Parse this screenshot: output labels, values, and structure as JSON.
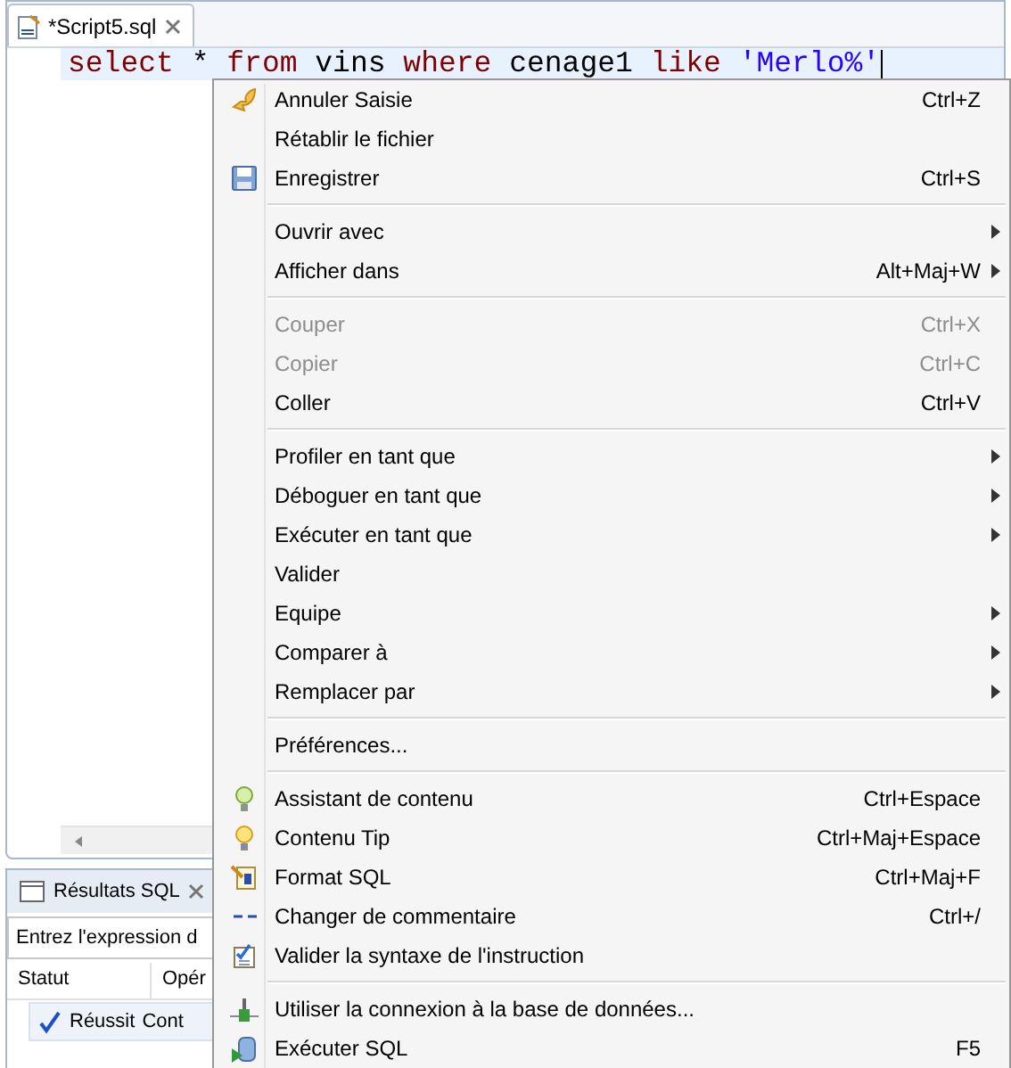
{
  "editor": {
    "tab": {
      "title": "*Script5.sql",
      "selected": true
    },
    "code": [
      {
        "kind": "keyword",
        "text": "select"
      },
      {
        "kind": "plain",
        "text": "*"
      },
      {
        "kind": "keyword",
        "text": "from"
      },
      {
        "kind": "plain",
        "text": "vins"
      },
      {
        "kind": "keyword",
        "text": "where"
      },
      {
        "kind": "plain",
        "text": "cenage1"
      },
      {
        "kind": "keyword",
        "text": "like"
      },
      {
        "kind": "string",
        "text": "'Merlo%'"
      }
    ]
  },
  "results": {
    "tab": {
      "title": "Résultats SQL",
      "selected": false
    },
    "filter": {
      "placeholder": "Entrez l'expression d"
    },
    "columns": [
      "Statut",
      "Opér"
    ],
    "rows": [
      {
        "status": "Réussit",
        "operation": "Cont",
        "selected": true
      }
    ]
  },
  "menu": {
    "items": [
      {
        "kind": "undo",
        "label": "Annuler Saisie",
        "shortcut": "Ctrl+Z",
        "disabled": false
      },
      {
        "kind": "item",
        "label": "Rétablir le fichier",
        "disabled": false
      },
      {
        "kind": "save",
        "label": "Enregistrer",
        "shortcut": "Ctrl+S",
        "disabled": false
      },
      {
        "kind": "separator"
      },
      {
        "kind": "item",
        "label": "Ouvrir avec",
        "submenu": true,
        "disabled": false
      },
      {
        "kind": "item",
        "label": "Afficher dans",
        "shortcut": "Alt+Maj+W",
        "submenu": true,
        "disabled": false
      },
      {
        "kind": "separator"
      },
      {
        "kind": "item",
        "label": "Couper",
        "shortcut": "Ctrl+X",
        "disabled": true
      },
      {
        "kind": "item",
        "label": "Copier",
        "shortcut": "Ctrl+C",
        "disabled": true
      },
      {
        "kind": "item",
        "label": "Coller",
        "shortcut": "Ctrl+V",
        "disabled": false
      },
      {
        "kind": "separator"
      },
      {
        "kind": "item",
        "label": "Profiler en tant que",
        "submenu": true,
        "disabled": false
      },
      {
        "kind": "item",
        "label": "Déboguer en tant que",
        "submenu": true,
        "disabled": false
      },
      {
        "kind": "item",
        "label": "Exécuter en tant que",
        "submenu": true,
        "disabled": false
      },
      {
        "kind": "item",
        "label": "Valider",
        "disabled": false
      },
      {
        "kind": "item",
        "label": "Equipe",
        "submenu": true,
        "disabled": false
      },
      {
        "kind": "item",
        "label": "Comparer à",
        "submenu": true,
        "disabled": false
      },
      {
        "kind": "item",
        "label": "Remplacer par",
        "submenu": true,
        "disabled": false
      },
      {
        "kind": "separator"
      },
      {
        "kind": "item",
        "label": "Préférences...",
        "disabled": false
      },
      {
        "kind": "separator"
      },
      {
        "kind": "assist",
        "label": "Assistant de contenu",
        "shortcut": "Ctrl+Espace",
        "disabled": false
      },
      {
        "kind": "tip",
        "label": "Contenu Tip",
        "shortcut": "Ctrl+Maj+Espace",
        "disabled": false
      },
      {
        "kind": "format",
        "label": "Format SQL",
        "shortcut": "Ctrl+Maj+F",
        "disabled": false
      },
      {
        "kind": "comment",
        "label": "Changer de commentaire",
        "shortcut": "Ctrl+/",
        "disabled": false
      },
      {
        "kind": "validate",
        "label": "Valider la syntaxe de l'instruction",
        "disabled": false
      },
      {
        "kind": "separator"
      },
      {
        "kind": "connect",
        "label": "Utiliser la connexion à la base de données...",
        "disabled": false
      },
      {
        "kind": "run",
        "label": "Exécuter SQL",
        "shortcut": "F5",
        "disabled": false
      }
    ]
  }
}
